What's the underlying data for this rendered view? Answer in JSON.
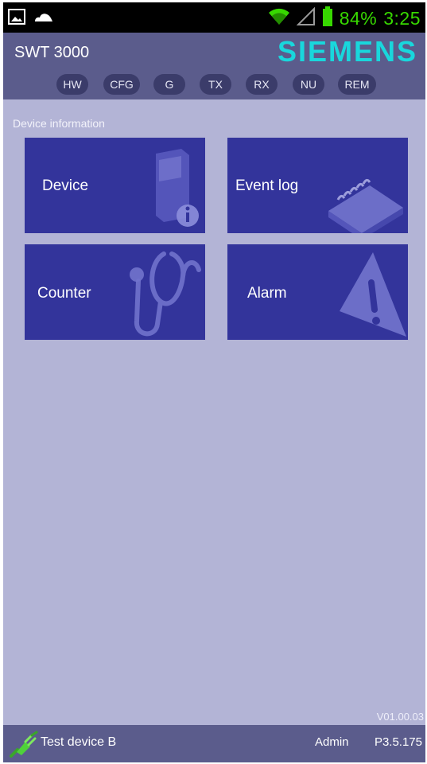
{
  "status_bar": {
    "battery": "84%",
    "time": "3:25",
    "icons": [
      "gallery-icon",
      "cloud-icon",
      "wifi-icon",
      "signal-icon",
      "battery-icon"
    ]
  },
  "header": {
    "app_title": "SWT 3000",
    "brand": "SIEMENS",
    "chips": [
      "HW",
      "CFG",
      "G",
      "TX",
      "RX",
      "NU",
      "REM"
    ]
  },
  "main": {
    "section_label": "Device information",
    "tiles": [
      {
        "label": "Device",
        "icon": "device-info-icon"
      },
      {
        "label": "Event log",
        "icon": "notebook-icon"
      },
      {
        "label": "Counter",
        "icon": "stethoscope-icon"
      },
      {
        "label": "Alarm",
        "icon": "warning-icon"
      }
    ],
    "version": "V01.00.03"
  },
  "footer": {
    "device_name": "Test device B",
    "user_role": "Admin",
    "firmware": "P3.5.175",
    "connection_icon": "connection-plug-icon"
  },
  "colors": {
    "background": "#b3b4d6",
    "header": "#5b5c8c",
    "tile": "#33349b",
    "brand": "#19d7dc",
    "status_text": "#37d800"
  }
}
